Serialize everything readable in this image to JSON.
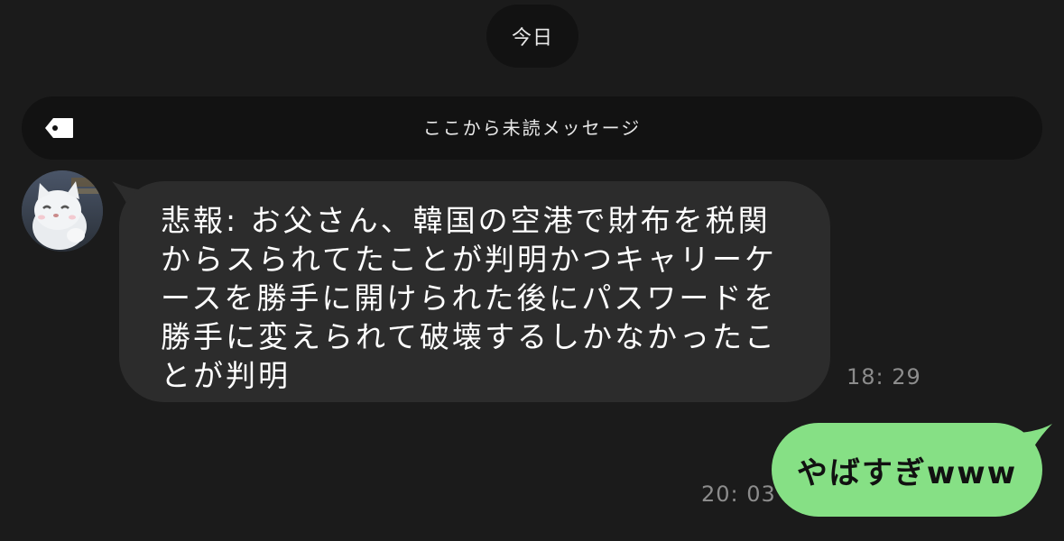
{
  "date_separator": "今日",
  "unread_divider": {
    "label": "ここから未読メッセージ",
    "icon": "tag-icon"
  },
  "messages": [
    {
      "direction": "incoming",
      "avatar": "cat-avatar",
      "text": "悲報: お父さん、韓国の空港で財布を税関からスられてたことが判明かつキャリーケースを勝手に開けられた後にパスワードを勝手に変えられて破壊するしかなかったことが判明",
      "time": "18: 29"
    },
    {
      "direction": "outgoing",
      "text": "やばすぎwww",
      "time": "20: 03"
    }
  ],
  "colors": {
    "background": "#1b1b1b",
    "chip": "#121212",
    "incoming_bubble": "#2c2c2c",
    "outgoing_bubble": "#86e085",
    "timestamp": "#8c8c8c"
  }
}
